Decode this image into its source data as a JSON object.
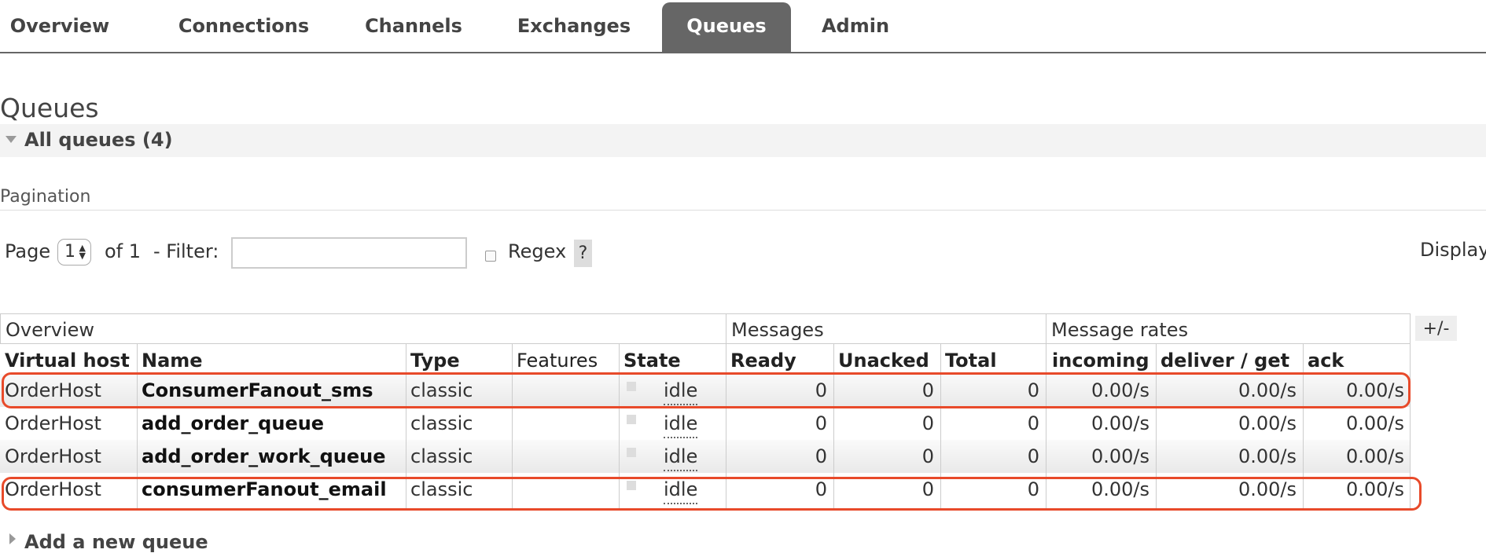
{
  "nav": {
    "tabs": [
      {
        "label": "Overview"
      },
      {
        "label": "Connections"
      },
      {
        "label": "Channels"
      },
      {
        "label": "Exchanges"
      },
      {
        "label": "Queues",
        "active": true
      },
      {
        "label": "Admin"
      }
    ]
  },
  "page_title": "Queues",
  "section": {
    "title": "All queues (4)"
  },
  "pagination": {
    "heading": "Pagination",
    "page_label": "Page",
    "page_value": "1",
    "of_label": "of 1",
    "filter_label": "- Filter:",
    "filter_value": "",
    "regex_label": "Regex",
    "help_label": "?",
    "display_label": "Display"
  },
  "table": {
    "groups": [
      "Overview",
      "Messages",
      "Message rates"
    ],
    "plus_minus": "+/-",
    "columns": [
      "Virtual host",
      "Name",
      "Type",
      "Features",
      "State",
      "Ready",
      "Unacked",
      "Total",
      "incoming",
      "deliver / get",
      "ack"
    ],
    "rows": [
      {
        "vhost": "OrderHost",
        "name": "ConsumerFanout_sms",
        "type": "classic",
        "features": "",
        "state": "idle",
        "ready": "0",
        "unacked": "0",
        "total": "0",
        "incoming": "0.00/s",
        "deliver": "0.00/s",
        "ack": "0.00/s"
      },
      {
        "vhost": "OrderHost",
        "name": "add_order_queue",
        "type": "classic",
        "features": "",
        "state": "idle",
        "ready": "0",
        "unacked": "0",
        "total": "0",
        "incoming": "0.00/s",
        "deliver": "0.00/s",
        "ack": "0.00/s"
      },
      {
        "vhost": "OrderHost",
        "name": "add_order_work_queue",
        "type": "classic",
        "features": "",
        "state": "idle",
        "ready": "0",
        "unacked": "0",
        "total": "0",
        "incoming": "0.00/s",
        "deliver": "0.00/s",
        "ack": "0.00/s"
      },
      {
        "vhost": "OrderHost",
        "name": "consumerFanout_email",
        "type": "classic",
        "features": "",
        "state": "idle",
        "ready": "0",
        "unacked": "0",
        "total": "0",
        "incoming": "0.00/s",
        "deliver": "0.00/s",
        "ack": "0.00/s"
      }
    ]
  },
  "add_queue": {
    "label": "Add a new queue"
  },
  "colors": {
    "active_tab": "#666666",
    "highlight": "#e84a2a"
  }
}
